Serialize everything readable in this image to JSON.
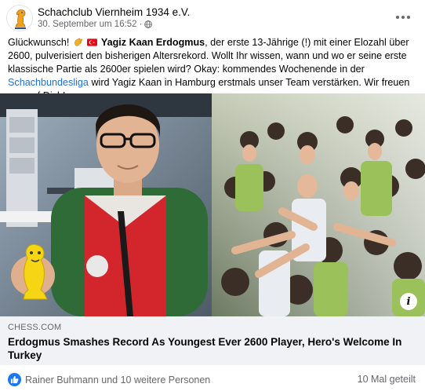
{
  "header": {
    "page_name": "Schachclub Viernheim 1934 e.V.",
    "timestamp": "30. September um 16:52",
    "separator": "·",
    "privacy_icon": "globe-icon",
    "more_icon": "more-options-icon"
  },
  "post": {
    "segments": [
      "Glückwunsch!",
      "Yagiz Kaan Erdogmus",
      ", der erste 13-Jährige (!) mit einer Elozahl über 2600, pulverisiert den bisherigen Altersrekord. Wollt Ihr wissen, wann und wo er seine erste klassische Partie als 2600er spielen wird? Okay: kommendes Wochenende in der",
      "Schachbundesliga",
      "wird Yagiz Kaan in Hamburg erstmals unser Team verstärken. Wir freuen uns auf Dich!"
    ],
    "emojis": [
      "clapping-hands-emoji",
      "turkey-flag-emoji"
    ]
  },
  "link_card": {
    "domain": "CHESS.COM",
    "title": "Erdogmus Smashes Record As Youngest Ever 2600 Player, Hero's Welcome In Turkey",
    "info_icon": "info-icon"
  },
  "footer": {
    "reactions_text": "Rainer Buhmann und 10 weitere Personen",
    "shares_text": "10 Mal geteilt",
    "reaction_icon": "like-icon"
  },
  "colors": {
    "link": "#216fdb",
    "secondary_text": "#65676b",
    "card_bg": "#f0f2f5",
    "like_blue": "#1877f2"
  }
}
